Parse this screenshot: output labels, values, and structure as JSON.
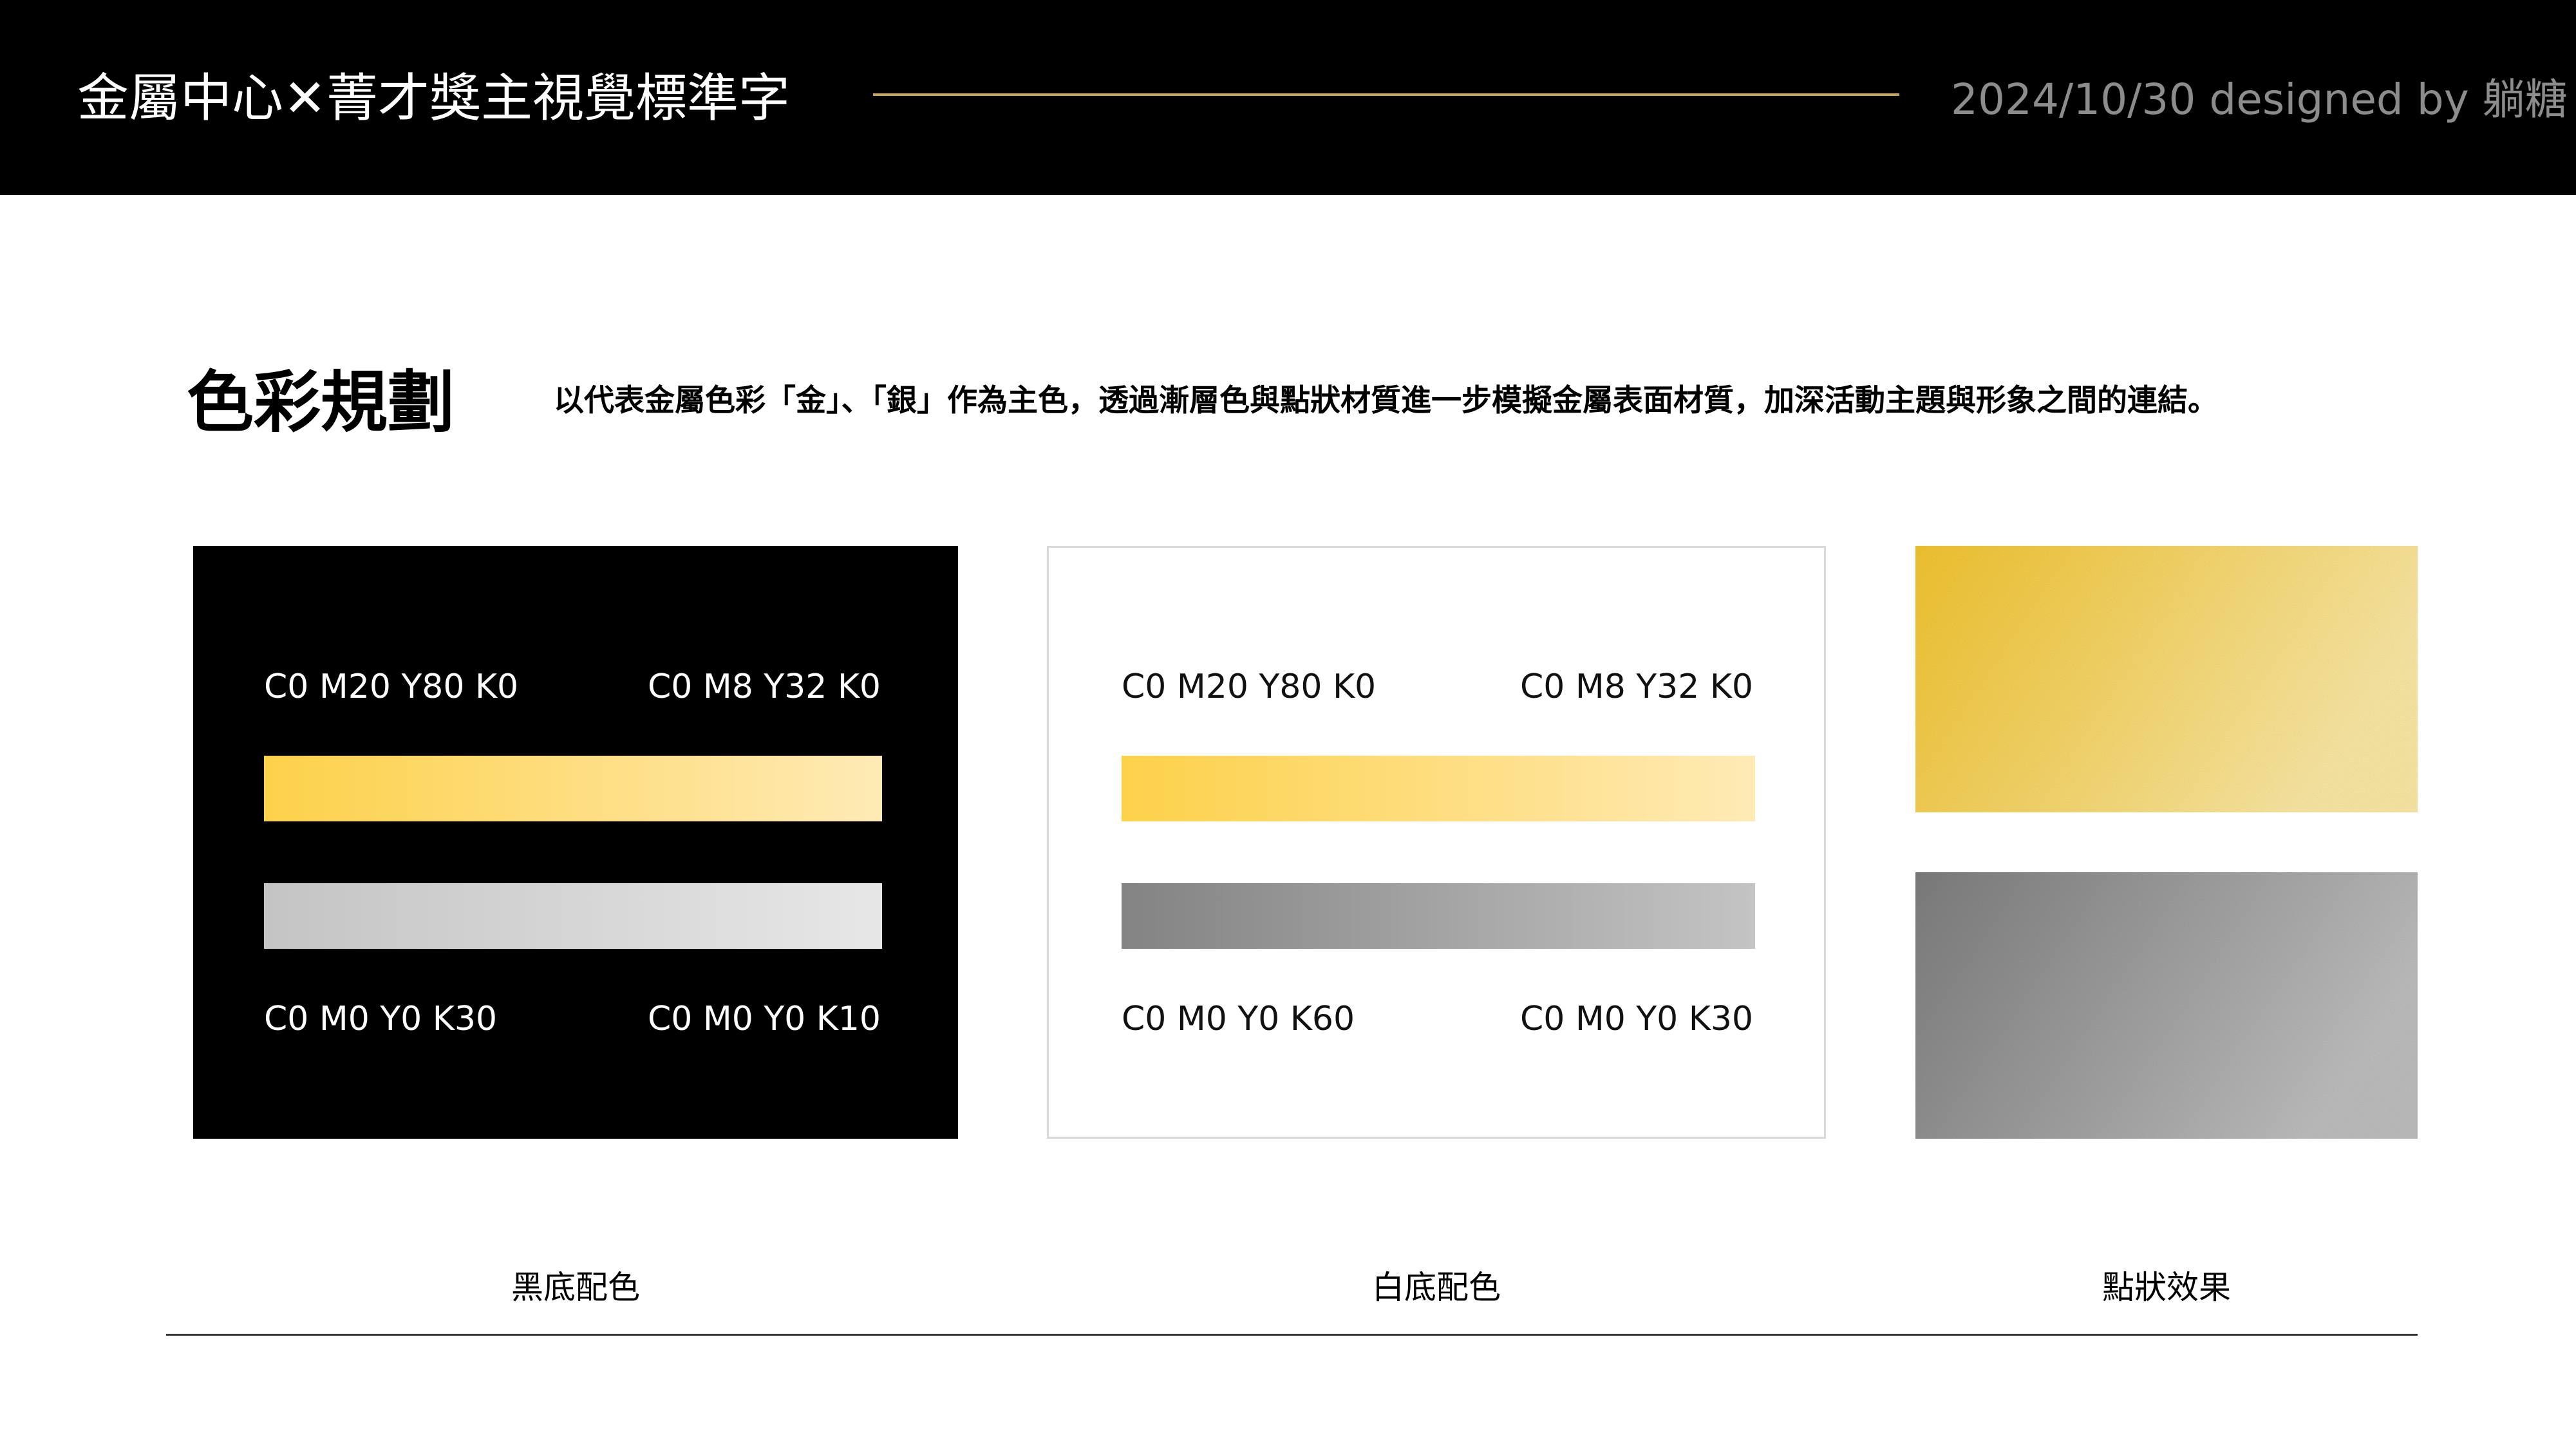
{
  "header": {
    "title": "金屬中心✕菁才獎主視覺標準字",
    "meta": "2024/10/30 designed by 躺糖"
  },
  "section": {
    "title": "色彩規劃",
    "description": "以代表金屬色彩「金」、「銀」作為主色，透過漸層色與點狀材質進一步模擬金屬表面材質，加深活動主題與形象之間的連結。"
  },
  "panels": {
    "dark": {
      "gold_start": "C0 M20 Y80 K0",
      "gold_end": "C0 M8 Y32 K0",
      "silver_start": "C0 M0 Y0 K30",
      "silver_end": "C0 M0 Y0 K10",
      "caption": "黑底配色"
    },
    "light": {
      "gold_start": "C0 M20 Y80 K0",
      "gold_end": "C0 M8 Y32 K0",
      "silver_start": "C0 M0 Y0 K60",
      "silver_end": "C0 M0 Y0 K30",
      "caption": "白底配色"
    },
    "texture": {
      "caption": "點狀效果"
    }
  },
  "colors": {
    "gold_start": "#fdd14a",
    "gold_end": "#feeab5",
    "silver_k10": "#e7e7e7",
    "silver_k30": "#c4c4c4",
    "silver_k60": "#838383",
    "accent_rule": "#c9a24a"
  }
}
